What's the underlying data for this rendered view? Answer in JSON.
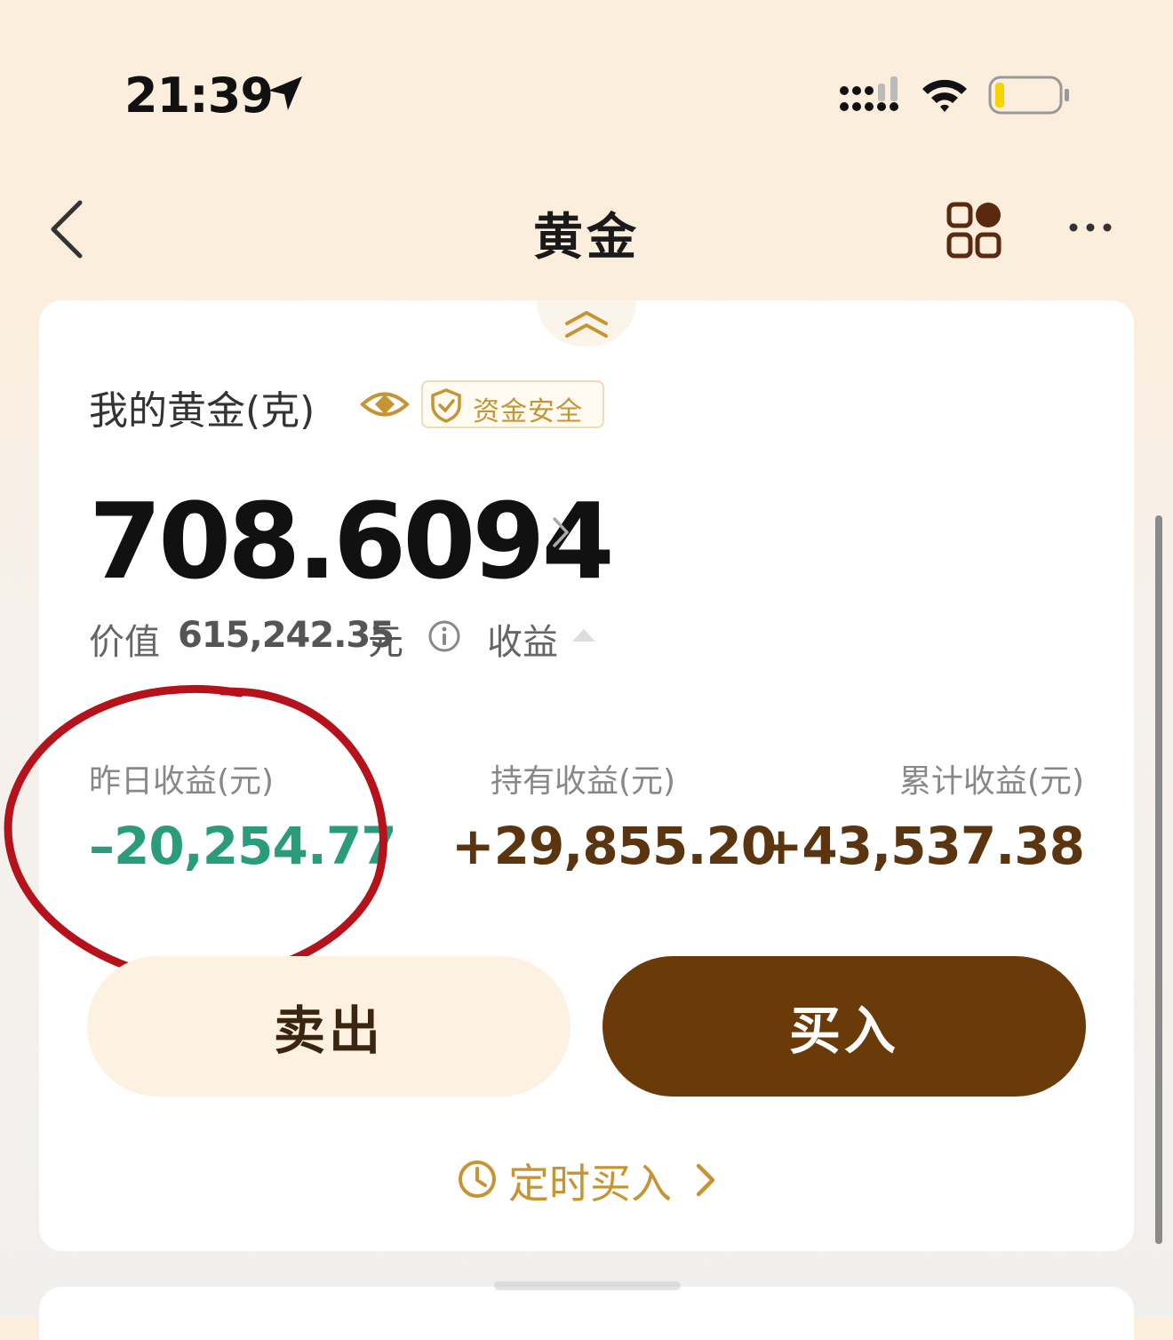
{
  "status_bar": {
    "time": "21:39",
    "icons": [
      "location-arrow-icon",
      "signal-icon",
      "wifi-icon",
      "battery-icon"
    ],
    "battery_level": 0.12
  },
  "nav": {
    "title": "黄金",
    "back_icon": "chevron-left-icon",
    "apps_icon": "apps-grid-icon",
    "more_icon": "more-dots-icon"
  },
  "holdings": {
    "label": "我的黄金(克)",
    "badge": "资金安全",
    "grams": "708.6094",
    "value_label": "价值",
    "value_amount": "615,242.35",
    "value_unit": "元",
    "earnings_toggle": "收益"
  },
  "stats": {
    "yesterday": {
      "label": "昨日收益(元)",
      "value": "–20,254.77"
    },
    "holding": {
      "label": "持有收益(元)",
      "value": "+29,855.20"
    },
    "cumulative": {
      "label": "累计收益(元)",
      "value": "+43,537.38"
    }
  },
  "actions": {
    "sell": "卖出",
    "buy": "买入",
    "schedule": "定时买入"
  },
  "colors": {
    "header_bg": "#fbeedd",
    "gold_accent": "#c79433",
    "brown_primary": "#6a3a08",
    "loss_green": "#2a9c7c",
    "gain_brown": "#5a3510",
    "annotation_red": "#b5121b"
  }
}
